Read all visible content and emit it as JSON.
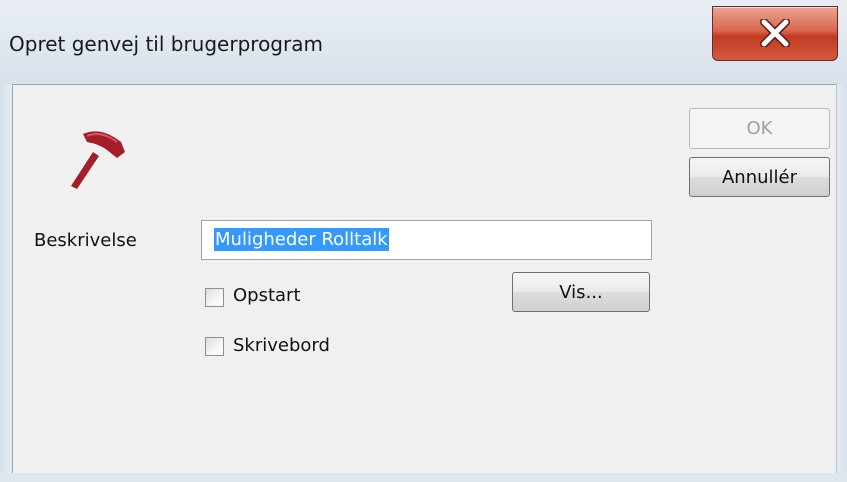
{
  "window": {
    "title": "Opret genvej til brugerprogram",
    "close_icon": "close-icon",
    "accent_close": "#c7452a"
  },
  "icon": {
    "name": "hammer-icon",
    "color": "#a31d2a"
  },
  "buttons": {
    "ok_label": "OK",
    "ok_enabled": false,
    "cancel_label": "Annullér",
    "vis_label": "Vis..."
  },
  "form": {
    "description_label": "Beskrivelse",
    "description_value": "Muligheder Rolltalk",
    "description_selected": true,
    "startup_label": "Opstart",
    "startup_checked": false,
    "desktop_label": "Skrivebord",
    "desktop_checked": false
  }
}
